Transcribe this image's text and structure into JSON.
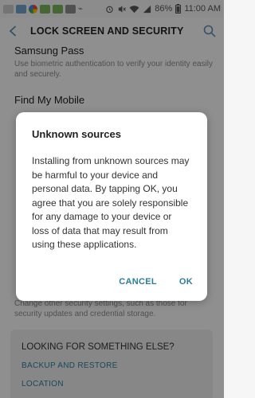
{
  "status_bar": {
    "battery": "86%",
    "time": "11:00 AM",
    "notification_icons": [
      "gallery-icon",
      "gallery-icon",
      "google-photos-icon",
      "gallery-icon",
      "gallery-icon",
      "gallery-icon",
      "usb-icon"
    ],
    "system_icons": [
      "alarm-icon",
      "mute-icon",
      "wifi-icon",
      "signal-icon",
      "battery-icon"
    ]
  },
  "header": {
    "title": "LOCK SCREEN AND SECURITY"
  },
  "list": {
    "samsung_pass": {
      "title": "Samsung Pass",
      "description": "Use biometric authentication to verify your identity easily and securely."
    },
    "find_my_mobile": {
      "title": "Find My Mobile"
    },
    "other_security": {
      "description": "Change other security settings, such as those for security updates and credential storage."
    }
  },
  "more_card": {
    "title": "LOOKING FOR SOMETHING ELSE?",
    "links": [
      "BACKUP AND RESTORE",
      "LOCATION"
    ]
  },
  "dialog": {
    "title": "Unknown sources",
    "body": "Installing from unknown sources may be harmful to your device and personal data. By tapping OK, you agree that you are solely responsible for any damage to your device or loss of data that may result from using these applications.",
    "cancel_label": "CANCEL",
    "ok_label": "OK"
  },
  "colors": {
    "accent": "#2b7c9f",
    "scrim": "#000000"
  }
}
